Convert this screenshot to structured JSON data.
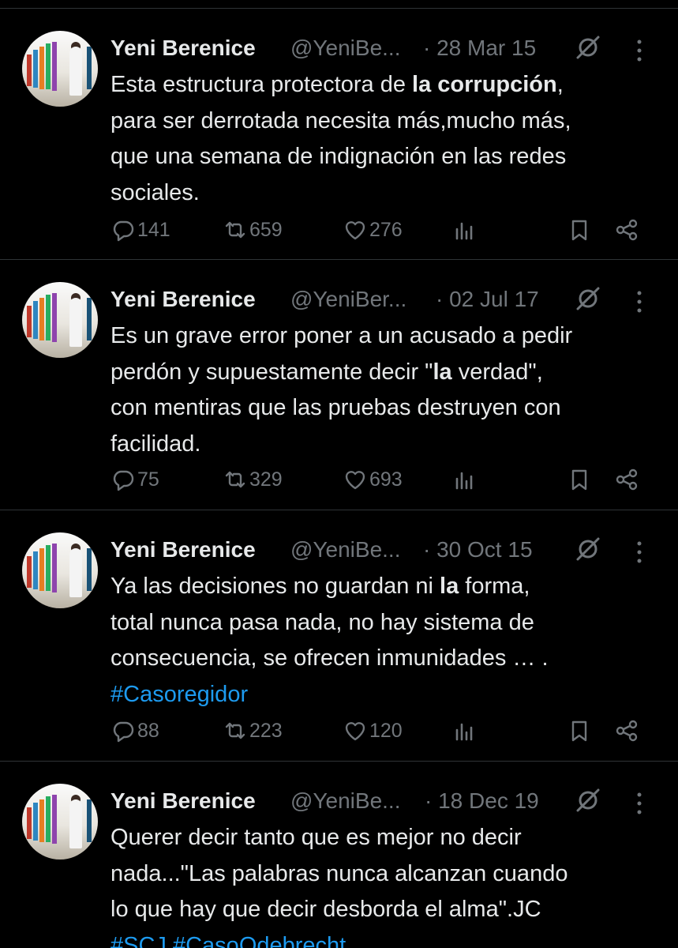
{
  "tweets": [
    {
      "name": "Yeni Berenice",
      "handle": "@YeniBe...",
      "date": "· 28 Mar 15",
      "text_parts": [
        {
          "t": "Esta estructura protectora de ",
          "b": false
        },
        {
          "t": "la corrupción",
          "b": true
        },
        {
          "t": ",\npara ser derrotada necesita más,mucho más,\nque una semana de indignación en las redes\nsociales.",
          "b": false
        }
      ],
      "replies": "141",
      "retweets": "659",
      "likes": "276"
    },
    {
      "name": "Yeni Berenice",
      "handle": "@YeniBer...",
      "date": "· 02 Jul 17",
      "text_parts": [
        {
          "t": "Es un grave error poner a un acusado a pedir\nperdón y supuestamente decir \"",
          "b": false
        },
        {
          "t": "la",
          "b": true
        },
        {
          "t": " verdad\",\ncon mentiras que las pruebas destruyen con\nfacilidad.",
          "b": false
        }
      ],
      "replies": "75",
      "retweets": "329",
      "likes": "693"
    },
    {
      "name": "Yeni Berenice",
      "handle": "@YeniBe...",
      "date": "· 30 Oct 15",
      "text_parts": [
        {
          "t": "Ya las decisiones no guardan ni ",
          "b": false
        },
        {
          "t": "la",
          "b": true
        },
        {
          "t": " forma,\ntotal nunca pasa nada, no hay sistema de\nconsecuencia, se ofrecen inmunidades … .\n",
          "b": false
        },
        {
          "t": "#Casoregidor",
          "tag": true
        }
      ],
      "replies": "88",
      "retweets": "223",
      "likes": "120"
    },
    {
      "name": "Yeni Berenice",
      "handle": "@YeniBe...",
      "date": "· 18 Dec 19",
      "text_parts": [
        {
          "t": "Querer decir tanto que es mejor no decir\nnada...\"Las palabras nunca alcanzan cuando\nlo que hay que decir desborda el alma\".JC\n",
          "b": false
        },
        {
          "t": "#SCJ",
          "tag": true
        },
        {
          "t": " ",
          "b": false
        },
        {
          "t": "#CasoOdebrecht",
          "tag": true
        }
      ],
      "replies": "",
      "retweets": "",
      "likes": ""
    }
  ],
  "icons": [
    "avatar-photo",
    "mute-icon",
    "more-icon",
    "reply-icon",
    "retweet-icon",
    "like-icon",
    "views-icon",
    "bookmark-icon",
    "share-icon"
  ],
  "colors": {
    "background": "#000000",
    "text": "#e7e9ea",
    "muted": "#71767b",
    "link": "#1d9bf0",
    "divider": "#2f3336"
  }
}
